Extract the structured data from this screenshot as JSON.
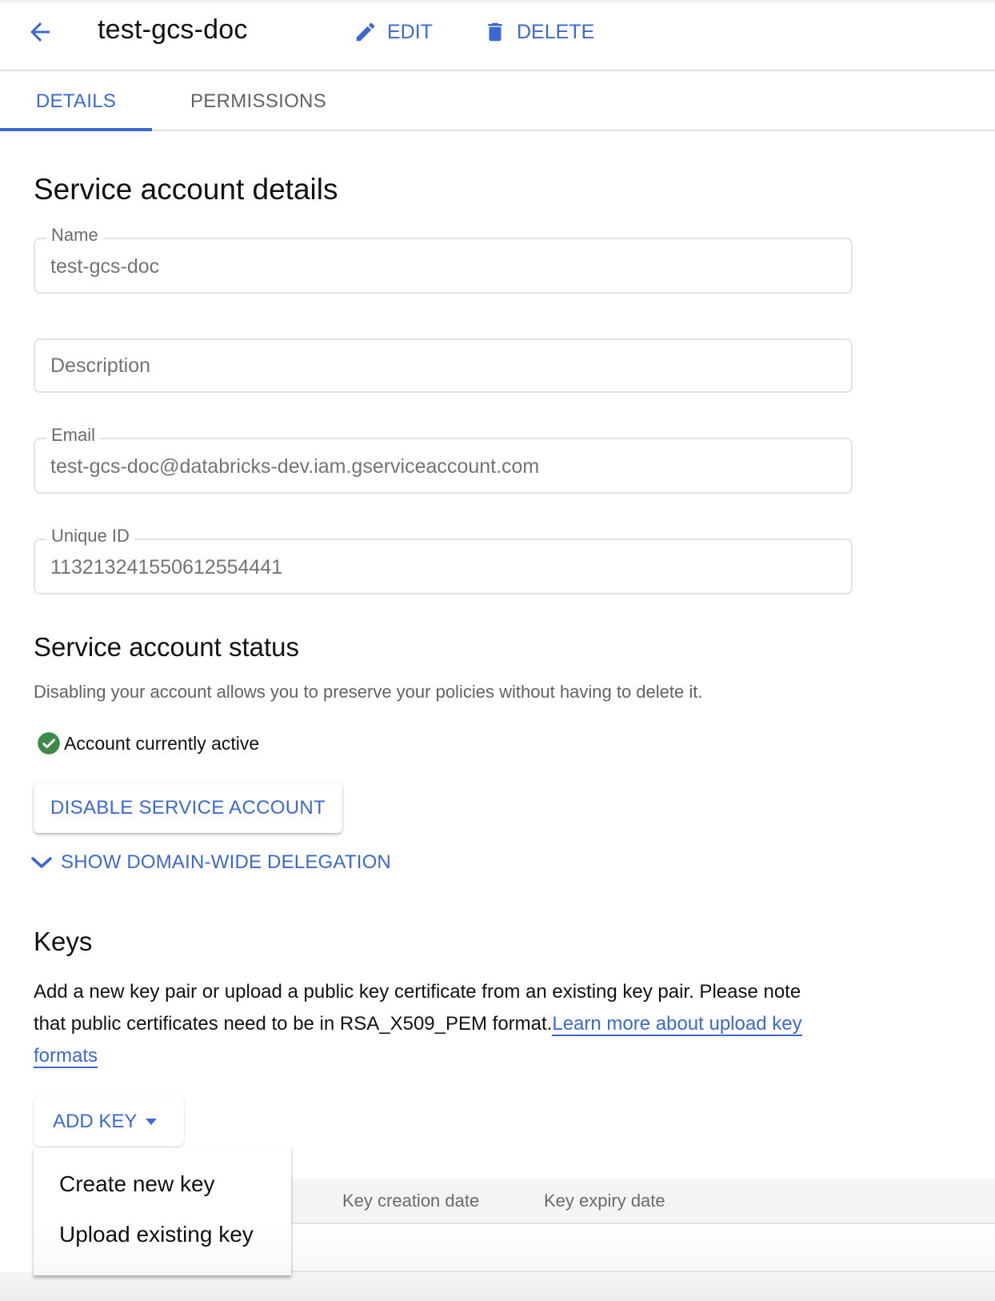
{
  "header": {
    "title": "test-gcs-doc",
    "back_icon": "arrow-left-icon",
    "edit_label": "EDIT",
    "edit_icon": "pencil-icon",
    "delete_label": "DELETE",
    "delete_icon": "trash-icon"
  },
  "tabs": [
    {
      "label": "DETAILS",
      "active": true
    },
    {
      "label": "PERMISSIONS",
      "active": false
    }
  ],
  "details": {
    "title": "Service account details",
    "fields": {
      "name": {
        "label": "Name",
        "value": "test-gcs-doc"
      },
      "description": {
        "label": "",
        "placeholder": "Description",
        "value": ""
      },
      "email": {
        "label": "Email",
        "value": "test-gcs-doc@databricks-dev.iam.gserviceaccount.com"
      },
      "unique_id": {
        "label": "Unique ID",
        "value": "113213241550612554441"
      }
    }
  },
  "status": {
    "title": "Service account status",
    "description": "Disabling your account allows you to preserve your policies without having to delete it.",
    "state_text": "Account currently active",
    "state_icon": "check-circle-icon",
    "state_color": "#3b8a47",
    "disable_button": "DISABLE SERVICE ACCOUNT",
    "delegation_toggle": "SHOW DOMAIN-WIDE DELEGATION",
    "delegation_icon": "chevron-down-icon"
  },
  "keys": {
    "title": "Keys",
    "description": "Add a new key pair or upload a public key certificate from an existing key pair. Please note that public certificates need to be in RSA_X509_PEM format.",
    "link_text": "Learn more about upload key formats",
    "add_key_button": "ADD KEY",
    "add_key_icon": "caret-down-icon",
    "menu": [
      {
        "label": "Create new key"
      },
      {
        "label": "Upload existing key"
      }
    ],
    "table": {
      "columns": [
        "Key creation date",
        "Key expiry date"
      ],
      "rows": []
    }
  },
  "colors": {
    "accent": "#3b69d1",
    "text_primary": "#111111",
    "text_secondary": "#5f6368",
    "border": "#e3e3e3"
  }
}
